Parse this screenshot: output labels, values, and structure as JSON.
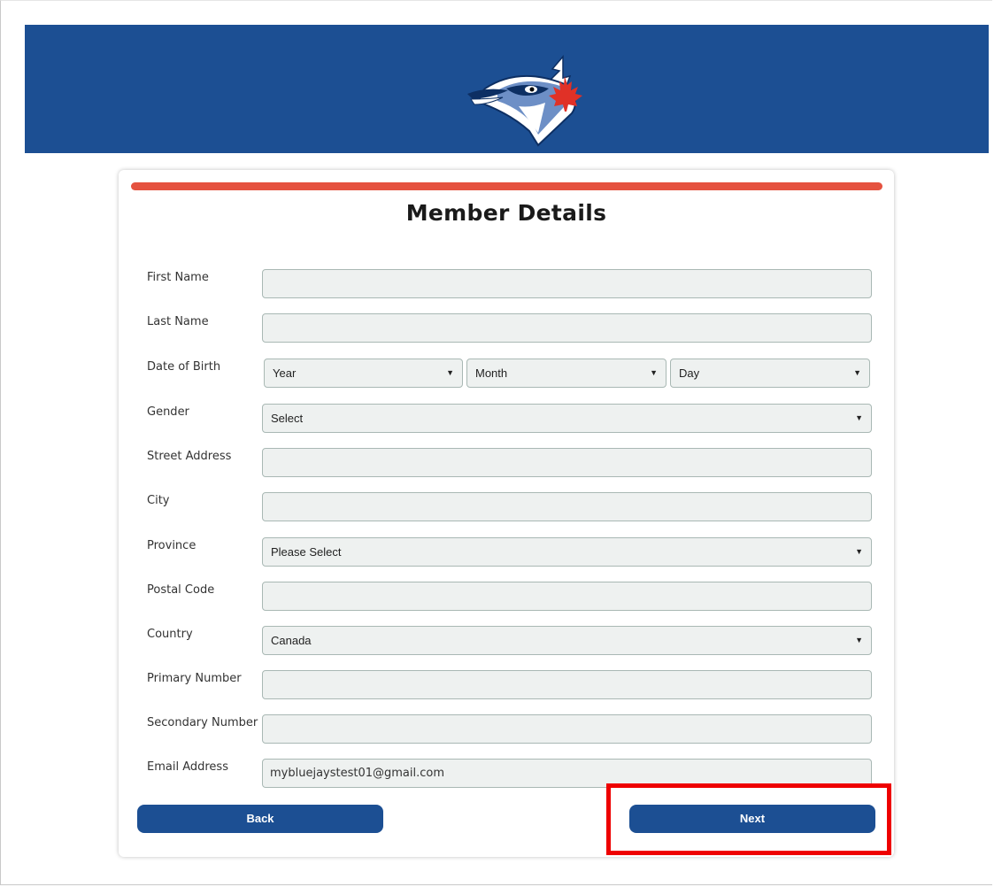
{
  "colors": {
    "header_bg": "#1c4f93",
    "progress": "#e5523f",
    "button_bg": "#1c4f93",
    "highlight": "#ee0000",
    "field_bg": "#eef1f0"
  },
  "header": {
    "logo_icon": "blue-jay-logo-icon"
  },
  "form": {
    "title": "Member Details",
    "progress_fraction": 1.0,
    "fields": {
      "first_name": {
        "label": "First Name",
        "value": ""
      },
      "last_name": {
        "label": "Last Name",
        "value": ""
      },
      "dob": {
        "label": "Date of Birth",
        "year": "Year",
        "month": "Month",
        "day": "Day"
      },
      "gender": {
        "label": "Gender",
        "value": "Select"
      },
      "street": {
        "label": "Street Address",
        "value": ""
      },
      "city": {
        "label": "City",
        "value": ""
      },
      "province": {
        "label": "Province",
        "value": "Please Select"
      },
      "postal": {
        "label": "Postal Code",
        "value": ""
      },
      "country": {
        "label": "Country",
        "value": "Canada"
      },
      "primary": {
        "label": "Primary Number",
        "value": ""
      },
      "secondary": {
        "label": "Secondary Number",
        "value": ""
      },
      "email": {
        "label": "Email Address",
        "value": "mybluejaystest01@gmail.com"
      }
    },
    "caret_glyph": "▼",
    "back_label": "Back",
    "next_label": "Next"
  }
}
